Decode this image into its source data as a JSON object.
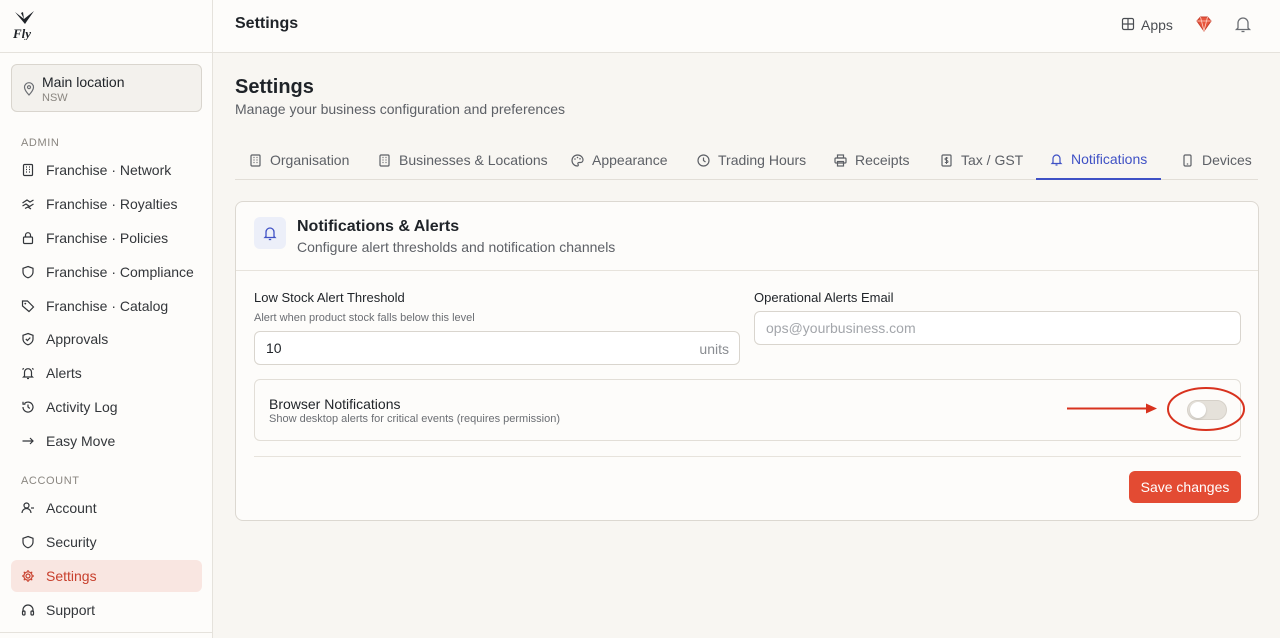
{
  "app": {
    "logo_text": "Fly"
  },
  "sidebar": {
    "location": {
      "name": "Main location",
      "sub": "NSW"
    },
    "admin_label": "ADMIN",
    "admin_items": [
      {
        "label": "Franchise · Network",
        "icon": "building-icon"
      },
      {
        "label": "Franchise · Royalties",
        "icon": "coins-icon"
      },
      {
        "label": "Franchise · Policies",
        "icon": "lock-icon"
      },
      {
        "label": "Franchise · Compliance",
        "icon": "shield-icon"
      },
      {
        "label": "Franchise · Catalog",
        "icon": "tag-icon"
      },
      {
        "label": "Approvals",
        "icon": "shield-check-icon"
      },
      {
        "label": "Alerts",
        "icon": "bell-alert-icon"
      },
      {
        "label": "Activity Log",
        "icon": "history-icon"
      },
      {
        "label": "Easy Move",
        "icon": "arrow-right-icon"
      }
    ],
    "account_label": "ACCOUNT",
    "account_items": [
      {
        "label": "Account",
        "icon": "user-icon"
      },
      {
        "label": "Security",
        "icon": "shield-icon"
      },
      {
        "label": "Settings",
        "icon": "gear-icon",
        "active": true
      },
      {
        "label": "Support",
        "icon": "headphones-icon"
      }
    ]
  },
  "header": {
    "title": "Settings",
    "apps_label": "Apps"
  },
  "page": {
    "title": "Settings",
    "subtitle": "Manage your business configuration and preferences"
  },
  "tabs": [
    {
      "label": "Organisation",
      "icon": "building-icon"
    },
    {
      "label": "Businesses & Locations",
      "icon": "building-icon"
    },
    {
      "label": "Appearance",
      "icon": "palette-icon"
    },
    {
      "label": "Trading Hours",
      "icon": "clock-icon"
    },
    {
      "label": "Receipts",
      "icon": "printer-icon"
    },
    {
      "label": "Tax / GST",
      "icon": "dollar-file-icon"
    },
    {
      "label": "Notifications",
      "icon": "bell-icon",
      "active": true
    },
    {
      "label": "Devices",
      "icon": "phone-icon"
    }
  ],
  "card": {
    "title": "Notifications & Alerts",
    "subtitle": "Configure alert thresholds and notification channels",
    "low_stock": {
      "label": "Low Stock Alert Threshold",
      "hint": "Alert when product stock falls below this level",
      "value": "10",
      "suffix": "units"
    },
    "ops_email": {
      "label": "Operational Alerts Email",
      "value": "",
      "placeholder": "ops@yourbusiness.com"
    },
    "browser_notifications": {
      "label": "Browser Notifications",
      "hint": "Show desktop alerts for critical events (requires permission)",
      "enabled": false
    },
    "save_label": "Save changes"
  },
  "colors": {
    "accent": "#e34b33",
    "tab_active": "#3f51c5",
    "annotation": "#d8321e"
  }
}
